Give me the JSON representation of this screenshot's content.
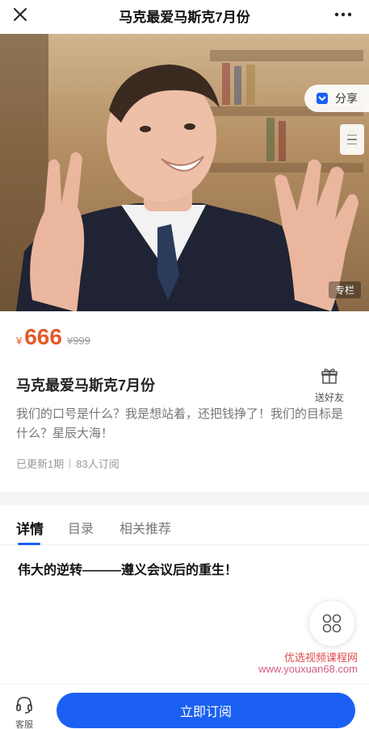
{
  "header": {
    "title": "马克最爱马斯克7月份"
  },
  "hero": {
    "share_label": "分享",
    "column_badge": "专栏"
  },
  "product": {
    "currency": "¥",
    "price": "666",
    "original_price": "¥999",
    "title": "马克最爱马斯克7月份",
    "gift_label": "送好友",
    "description": "我们的口号是什么？我是想站着，还把钱挣了！我们的目标是什么？星辰大海！",
    "updated": "已更新1期",
    "subscribers": "83人订阅"
  },
  "tabs": [
    {
      "label": "详情"
    },
    {
      "label": "目录"
    },
    {
      "label": "相关推荐"
    }
  ],
  "detail": {
    "heading": "伟大的逆转———遵义会议后的重生！"
  },
  "watermark": {
    "line1": "优选视频课程网",
    "line2": "www.youxuan68.com"
  },
  "bottom_bar": {
    "service_label": "客服",
    "subscribe_label": "立即订阅"
  },
  "colors": {
    "accent": "#1b60f2",
    "price": "#e35b2a"
  }
}
